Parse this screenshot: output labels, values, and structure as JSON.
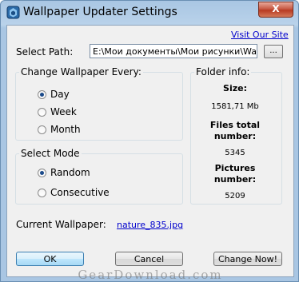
{
  "window": {
    "title": "Wallpaper Updater Settings",
    "close_glyph": "X"
  },
  "header": {
    "visit_link": "Visit Our Site"
  },
  "path": {
    "label": "Select Path:",
    "value": "E:\\Мои документы\\Мои рисунки\\Wallpapers",
    "browse_label": "..."
  },
  "change_group": {
    "title": "Change Wallpaper Every:",
    "options": [
      {
        "label": "Day",
        "selected": true
      },
      {
        "label": "Week",
        "selected": false
      },
      {
        "label": "Month",
        "selected": false
      }
    ]
  },
  "mode_group": {
    "title": "Select Mode",
    "options": [
      {
        "label": "Random",
        "selected": true
      },
      {
        "label": "Consecutive",
        "selected": false
      }
    ]
  },
  "folder_info": {
    "title": "Folder info:",
    "size_label": "Size:",
    "size_value": "1581,71 Mb",
    "files_label_1": "Files total",
    "files_label_2": "number:",
    "files_value": "5345",
    "pictures_label_1": "Pictures",
    "pictures_label_2": "number:",
    "pictures_value": "5209"
  },
  "current": {
    "label": "Current Wallpaper:",
    "file": "nature_835.jpg"
  },
  "buttons": {
    "ok": "OK",
    "cancel": "Cancel",
    "change_now": "Change Now!"
  },
  "watermark": "GearDownload.com",
  "colors": {
    "title_gradient": "#b9d2ea",
    "client_bg": "#f0f0f0",
    "link": "#0000cc",
    "close_red": "#c75a45"
  }
}
